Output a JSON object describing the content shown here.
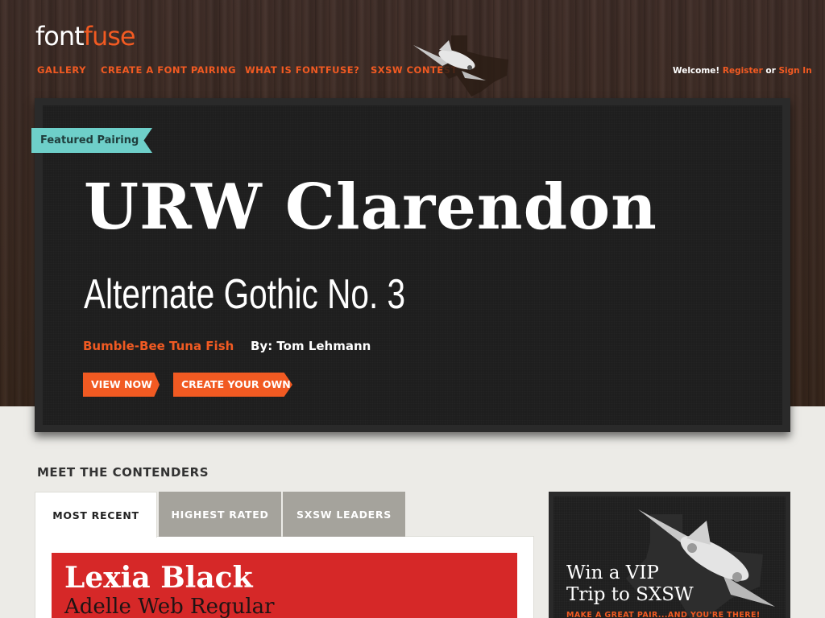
{
  "header": {
    "logo": {
      "part1": "font",
      "part2": "fuse"
    },
    "nav": [
      {
        "label": "GALLERY"
      },
      {
        "label": "CREATE A FONT PAIRING"
      },
      {
        "label": "WHAT IS FONTFUSE?"
      },
      {
        "label": "SXSW CONTEST"
      }
    ],
    "welcome": {
      "text": "Welcome!",
      "register": "Register",
      "or": "or",
      "sign_in": "Sign In"
    }
  },
  "featured": {
    "ribbon": "Featured Pairing",
    "heading_font": "URW Clarendon",
    "body_font": "Alternate Gothic No. 3",
    "pairing_name": "Bumble-Bee Tuna Fish",
    "author": "By: Tom Lehmann",
    "buttons": {
      "view": "VIEW NOW",
      "create": "CREATE YOUR OWN"
    }
  },
  "contenders": {
    "title": "MEET THE CONTENDERS",
    "tabs": [
      {
        "label": "MOST RECENT",
        "active": true
      },
      {
        "label": "HIGHEST RATED",
        "active": false
      },
      {
        "label": "SXSW LEADERS",
        "active": false
      }
    ],
    "cards": [
      {
        "heading_font": "Lexia Black",
        "body_font": "Adelle Web Regular"
      }
    ]
  },
  "promo": {
    "title": "Win a VIP\nTrip to SXSW",
    "cta": "MAKE A GREAT PAIR...AND YOU'RE THERE!"
  },
  "colors": {
    "accent": "#f15a22",
    "ribbon": "#6ecfc9",
    "card": "#d62828",
    "wood": "#3d2a1f",
    "board": "#1e1e1e"
  },
  "icons": [
    "airplane-illustration",
    "texas-map-outline"
  ]
}
